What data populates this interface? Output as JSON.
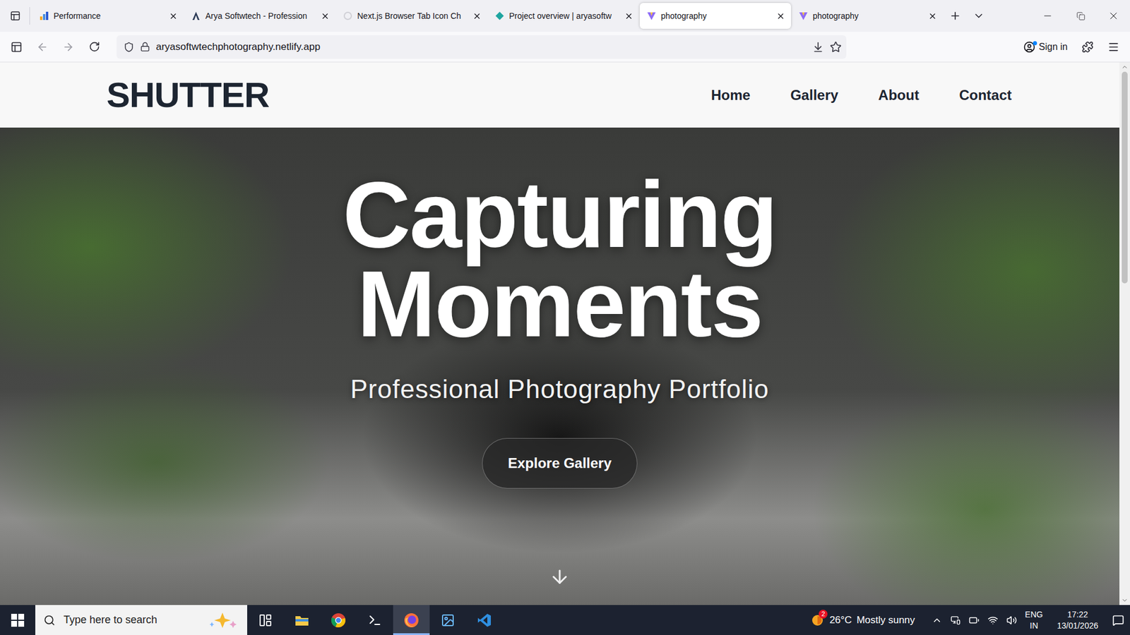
{
  "browser": {
    "tabs": [
      {
        "label": "Performance",
        "selected": false
      },
      {
        "label": "Arya Softwtech - Profession",
        "selected": false
      },
      {
        "label": "Next.js Browser Tab Icon Ch",
        "selected": false
      },
      {
        "label": "Project overview | aryasoftw",
        "selected": false
      },
      {
        "label": "photography",
        "selected": true
      },
      {
        "label": "photography",
        "selected": false
      }
    ],
    "address": "aryasoftwtechphotography.netlify.app",
    "sign_in": "Sign in"
  },
  "site": {
    "logo": "SHUTTER",
    "nav": [
      {
        "label": "Home"
      },
      {
        "label": "Gallery"
      },
      {
        "label": "About"
      },
      {
        "label": "Contact"
      }
    ],
    "hero": {
      "title_lines": [
        "Capturing",
        "Moments"
      ],
      "subtitle": "Professional Photography Portfolio",
      "button": "Explore Gallery"
    }
  },
  "taskbar": {
    "search_placeholder": "Type here to search",
    "apps": [
      {
        "selected": false
      },
      {
        "selected": false
      },
      {
        "selected": false
      },
      {
        "selected": false
      },
      {
        "selected": true
      },
      {
        "selected": false
      },
      {
        "selected": false
      }
    ],
    "weather": {
      "badge": "2",
      "temperature": "26°C",
      "condition": "Mostly sunny"
    },
    "language": [
      "ENG",
      "IN"
    ],
    "time": "17:22",
    "date": "13/01/2026"
  }
}
